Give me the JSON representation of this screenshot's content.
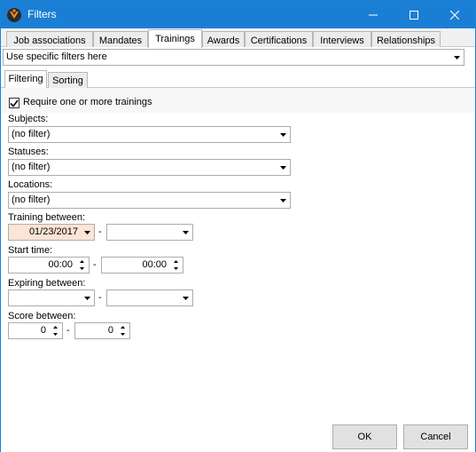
{
  "window": {
    "title": "Filters"
  },
  "tabs": [
    {
      "label": "Job associations"
    },
    {
      "label": "Mandates"
    },
    {
      "label": "Trainings"
    },
    {
      "label": "Awards"
    },
    {
      "label": "Certifications"
    },
    {
      "label": "Interviews"
    },
    {
      "label": "Relationships"
    }
  ],
  "active_tab": "Trainings",
  "filter_mode": {
    "value": "Use specific filters here"
  },
  "subtabs": [
    {
      "label": "Filtering"
    },
    {
      "label": "Sorting"
    }
  ],
  "filtering": {
    "require_checkbox": {
      "label": "Require one or more trainings",
      "checked": true
    },
    "subjects": {
      "label": "Subjects:",
      "value": "(no filter)"
    },
    "statuses": {
      "label": "Statuses:",
      "value": "(no filter)"
    },
    "locations": {
      "label": "Locations:",
      "value": "(no filter)"
    },
    "training_between": {
      "label": "Training between:",
      "from": "01/23/2017",
      "to": "",
      "separator": "-"
    },
    "start_time": {
      "label": "Start time:",
      "from": "00:00",
      "to": "00:00",
      "separator": "-"
    },
    "expiring_between": {
      "label": "Expiring between:",
      "from": "",
      "to": "",
      "separator": "-"
    },
    "score_between": {
      "label": "Score between:",
      "from": "0",
      "to": "0",
      "separator": "-"
    }
  },
  "buttons": {
    "ok": "OK",
    "cancel": "Cancel"
  },
  "colors": {
    "titlebar": "#1a7fd4",
    "date_highlight": "#fce4d6"
  }
}
